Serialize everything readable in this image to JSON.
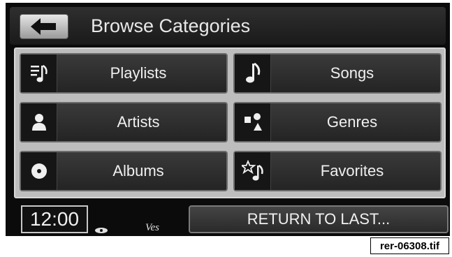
{
  "header": {
    "title": "Browse Categories",
    "back_icon": "arrow-left-icon"
  },
  "categories": [
    {
      "label": "Playlists",
      "icon": "playlist-icon"
    },
    {
      "label": "Songs",
      "icon": "music-note-icon"
    },
    {
      "label": "Artists",
      "icon": "person-icon"
    },
    {
      "label": "Genres",
      "icon": "genres-icon"
    },
    {
      "label": "Albums",
      "icon": "disc-icon"
    },
    {
      "label": "Favorites",
      "icon": "star-note-icon"
    }
  ],
  "footer": {
    "clock": "12:00",
    "vendor_mark": "Ves",
    "return_label": "RETURN TO LAST..."
  },
  "file_label": "rer-06308.tif"
}
